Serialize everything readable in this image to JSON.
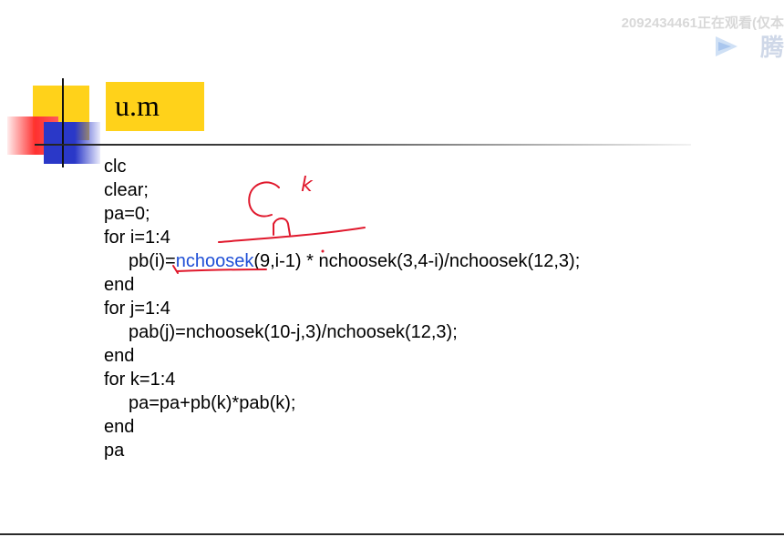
{
  "slide": {
    "title": "u.m",
    "code_lines": [
      "clc",
      "clear;",
      "pa=0;",
      "for i=1:4",
      "end",
      "for j=1:4",
      "pab(j)=nchoosek(10-j,3)/nchoosek(12,3);",
      "end",
      "for k=1:4",
      "pa=pa+pb(k)*pab(k);",
      "end",
      "pa"
    ],
    "line5": {
      "prefix": "pb(i)=",
      "highlight": "nchoosek",
      "middle": "(9,i-1)",
      "suffix": " * nchoosek(3,4-i)/nchoosek(12,3);"
    },
    "annotation": {
      "top_letter": "k",
      "bottom_letter": "n",
      "color": "#e0182c"
    },
    "colors": {
      "title_bg": "#ffd21a",
      "highlight_text": "#1f4fd6"
    }
  },
  "watermark": {
    "text": "2092434461正在观看(仅本",
    "logo": "play-triangle-logo",
    "fragment": "腾"
  }
}
